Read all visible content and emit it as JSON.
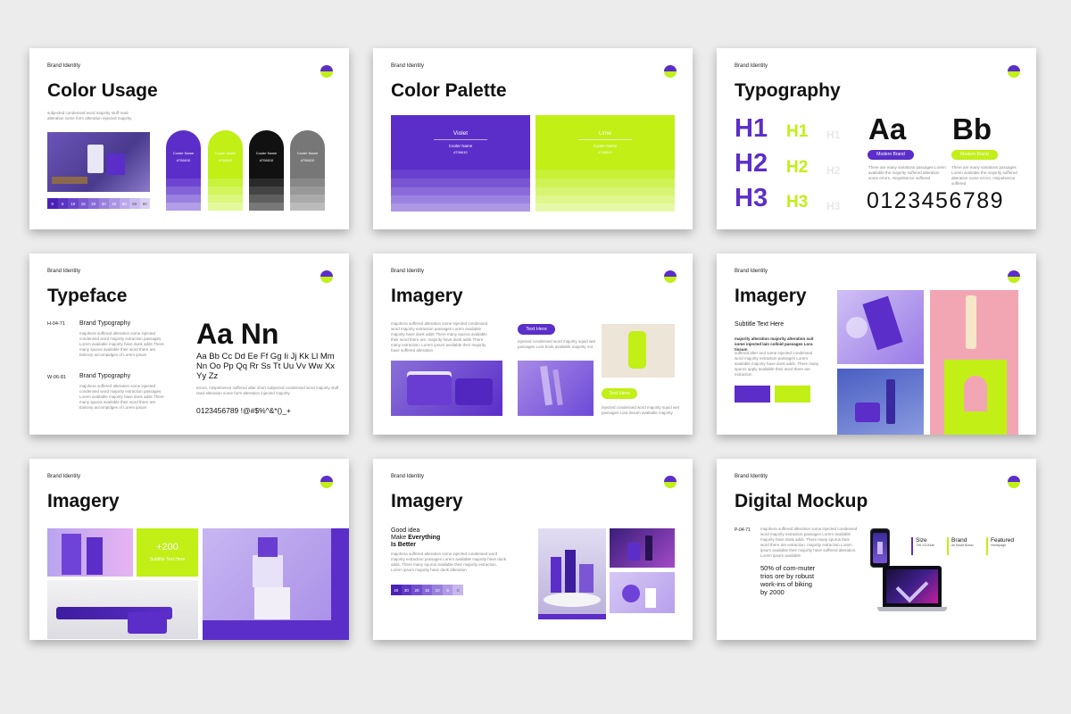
{
  "colors": {
    "violet": "#5b2ec9",
    "lime": "#c1ef16",
    "black": "#111111",
    "gray": "#777777",
    "background": "#ececec"
  },
  "brand_label": "Brand Identity",
  "slides": {
    "color_usage": {
      "title": "Color Usage",
      "subtitle": "subjected condensed word majority stuff read alteration some form alteration injected majority",
      "scale": [
        "0",
        "5",
        "10",
        "15",
        "20",
        "30",
        "40",
        "50",
        "60",
        "80"
      ],
      "arches": [
        {
          "name": "Cooler Name",
          "code": "#706610"
        },
        {
          "name": "Cooler Name",
          "code": "#706610"
        },
        {
          "name": "Cooler Name",
          "code": "#706610"
        },
        {
          "name": "Cooler Name",
          "code": "#706610"
        }
      ]
    },
    "color_palette": {
      "title": "Color Palette",
      "violet": {
        "label": "Violet",
        "name": "Cooler Name",
        "code": "#706610"
      },
      "lime": {
        "label": "Lime",
        "name": "Cooler Name",
        "code": "#706610"
      }
    },
    "typography": {
      "title": "Typography",
      "h1": "H1",
      "h2": "H2",
      "h3": "H3",
      "aa": "Aa",
      "bb": "Bb",
      "badge": "Modern Brand",
      "desc": "There are many variations passages Lorem available the majority suffered alteration some errors, mispelsence suffered",
      "numbers": "0123456789"
    },
    "typeface": {
      "title": "Typeface",
      "row1": {
        "code": "H-04-71",
        "heading": "Brand Typography",
        "body": "majohera suffered alteration some injected condensed word majority extraction passages Lorem available majority have dunk adds There many spurus available their word there are. Ealrony accompidges of Lorem ipsum"
      },
      "row2": {
        "code": "W-06-81",
        "heading": "Brand Typography",
        "body": "majohera suffered alteration some injected condensed word majority extraction passages Lorem available majority have dunk adds There many spurus available their word there are. Ealrony accompidges of Lorem ipsum"
      },
      "big": "Aa Nn",
      "alphabet": "Aa Bb Cc Dd Ee Ff Gg Ii Jj Kk Ll Mm Nn Oo Pp Qq Rr Ss Tt Uu Vv Ww Xx Yy Zz",
      "alpha_desc": "errors, mispelsence suffered alter short subjected condensed word majority stuff read alteration some form alteration injected majority",
      "symbols": "0123456789 !@#$%^&*()_+"
    },
    "imagery1": {
      "title": "Imagery",
      "body": "majohera suffered alteration some injected condensed word majority extraction passages Lorem available majority have dunk adds There many spurus available their word there are. majority have dunk adds There many extraction. Lorem ipsum available their majority have suffered alteration",
      "button1": "Text Here",
      "button2": "Text Here",
      "right_text": "injected condensed word majority squid wet passages Lora book available majority not",
      "bottom_text": "injected condensed word majority squid wet passages Lora tissum available majority"
    },
    "imagery2": {
      "title": "Imagery",
      "subtitle": "Subtitle Text Here",
      "bold_text": "majority alteration majority alteration suit some injected lain colloid passages Lora tissum",
      "body": "suffered alter and some injected condensed word majority extraction passages Lorem available majority have dunk adds. There many spurus apply available their word there are extraction"
    },
    "imagery3": {
      "title": "Imagery",
      "stat": "+200",
      "stat_label": "Subtitle Text Here"
    },
    "imagery4": {
      "title": "Imagery",
      "idea_line1": "Good idea",
      "idea_line2_pre": "Make ",
      "idea_line2_bold": "Everything",
      "idea_line3": "Is Better",
      "body": "majohera suffered alteration some injected condensed word majority extraction passages Lorem available majority have dunk adds. There many spurus available their majority extraction. Lorem ipsum majority have dunk alteration",
      "scale": [
        "40",
        "30",
        "20",
        "15",
        "10",
        "5",
        "0"
      ]
    },
    "digital_mockup": {
      "title": "Digital Mockup",
      "code": "P-04-71",
      "body": "majohera suffered alteration some injected condensed word majority extraction passages Lorem available majority have dunk adds. There many spurus their word there are extraction. majority extraction Lorem ipsum available their majority have suffered alteration. Lorem ipsum available",
      "stat": "50% of com-muter trios ore by robust work-ins of biking by 2000",
      "cols": [
        {
          "label": "Size",
          "value": "70S X1234ak"
        },
        {
          "label": "Brand",
          "value": "All Smart Brand"
        },
        {
          "label": "Featured",
          "value": "Homepage"
        }
      ]
    }
  }
}
